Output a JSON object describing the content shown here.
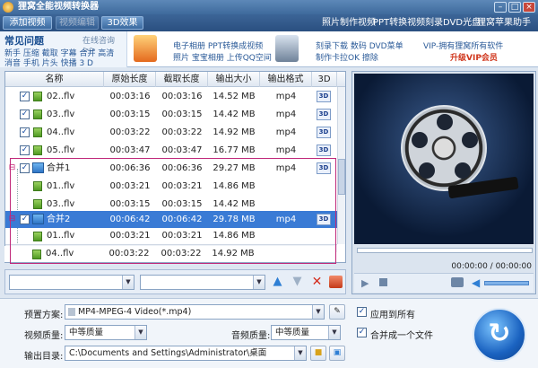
{
  "window": {
    "title": "狸窝全能视频转换器"
  },
  "toolbar": {
    "add_video": "添加视频",
    "video_edit": "视频编辑",
    "effect_3d": "3D效果",
    "links": [
      "照片制作视频",
      "PPT转换视频",
      "刻录DVD光盘",
      "狸窝苹果助手"
    ]
  },
  "faq": {
    "title": "常见问题",
    "more": "在线咨询>>",
    "row1": "新手 压缩 截取 字幕 合并 高清",
    "row2": "消音 手机 片头 快播 3 D"
  },
  "promo": {
    "a1": "电子相册 PPT转换成视频",
    "a2": "照片 宝宝相册 上传QQ空间",
    "b1": "刻录下载 数码 DVD菜单",
    "b2": "制作卡拉OK 擦除",
    "vip1": "VIP-拥有狸窝所有软件",
    "vip2": "升级VIP会员"
  },
  "table": {
    "headers": [
      "名称",
      "原始长度",
      "截取长度",
      "输出大小",
      "输出格式",
      "3D"
    ],
    "rows": [
      {
        "name": "02..flv",
        "orig": "00:03:16",
        "cut": "00:03:16",
        "size": "14.52 MB",
        "fmt": "mp4",
        "d3": "3D"
      },
      {
        "name": "03..flv",
        "orig": "00:03:15",
        "cut": "00:03:15",
        "size": "14.42 MB",
        "fmt": "mp4",
        "d3": "3D"
      },
      {
        "name": "04..flv",
        "orig": "00:03:22",
        "cut": "00:03:22",
        "size": "14.92 MB",
        "fmt": "mp4",
        "d3": "3D"
      },
      {
        "name": "05..flv",
        "orig": "00:03:47",
        "cut": "00:03:47",
        "size": "16.77 MB",
        "fmt": "mp4",
        "d3": "3D"
      },
      {
        "name": "合并1",
        "orig": "00:06:36",
        "cut": "00:06:36",
        "size": "29.27 MB",
        "fmt": "mp4",
        "d3": "3D"
      },
      {
        "name": "01..flv",
        "orig": "00:03:21",
        "cut": "00:03:21",
        "size": "14.86 MB",
        "fmt": "",
        "d3": ""
      },
      {
        "name": "03..flv",
        "orig": "00:03:15",
        "cut": "00:03:15",
        "size": "14.42 MB",
        "fmt": "",
        "d3": ""
      },
      {
        "name": "合并2",
        "orig": "00:06:42",
        "cut": "00:06:42",
        "size": "29.78 MB",
        "fmt": "mp4",
        "d3": "3D"
      },
      {
        "name": "01..flv",
        "orig": "00:03:21",
        "cut": "00:03:21",
        "size": "14.86 MB",
        "fmt": "",
        "d3": ""
      },
      {
        "name": "04..flv",
        "orig": "00:03:22",
        "cut": "00:03:22",
        "size": "14.92 MB",
        "fmt": "",
        "d3": ""
      }
    ]
  },
  "player": {
    "time": "00:00:00 / 00:00:00"
  },
  "settings": {
    "preset_label": "预置方案:",
    "preset_value": "MP4-MPEG-4 Video(*.mp4)",
    "apply_all": "应用到所有",
    "video_quality_label": "视频质量:",
    "video_quality_value": "中等质量",
    "audio_quality_label": "音频质量:",
    "audio_quality_value": "中等质量",
    "merge_one": "合并成一个文件",
    "output_label": "输出目录:",
    "output_value": "C:\\Documents and Settings\\Administrator\\桌面"
  },
  "colors": {
    "accent": "#3a7bd5",
    "merge_border": "#c0297a",
    "vip_red": "#d0361c"
  }
}
